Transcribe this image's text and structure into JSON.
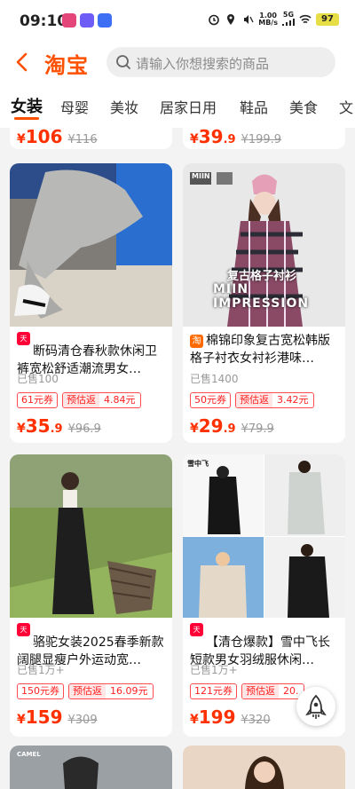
{
  "status_bar": {
    "time": "09:10",
    "net_speed_value": "1.00",
    "net_speed_unit": "MB/s",
    "network_type": "5G",
    "battery": "97"
  },
  "header": {
    "logo": "淘宝",
    "search_placeholder": "请输入你想搜索的商品"
  },
  "tabs": [
    "女装",
    "母婴",
    "美妆",
    "居家日用",
    "鞋品",
    "美食",
    "文"
  ],
  "top_partial": [
    {
      "price_int": "106",
      "price_dec": "",
      "original": "116"
    },
    {
      "price_int": "39",
      "price_dec": ".9",
      "original": "199.9"
    }
  ],
  "products": [
    {
      "badge": "天猫",
      "title": "断码清仓春秋款休闲卫裤宽松舒适潮流男女…",
      "sold": "已售100",
      "coupon": "61元券",
      "rebate_label": "预估返",
      "rebate_value": "4.84元",
      "price_int": "35",
      "price_dec": ".9",
      "original": "96.9"
    },
    {
      "badge": "淘",
      "title": "棉锦印象复古宽松韩版格子衬衣女衬衫港味…",
      "sold": "已售1400",
      "coupon": "50元券",
      "rebate_label": "预估返",
      "rebate_value": "3.42元",
      "price_int": "29",
      "price_dec": ".9",
      "original": "79.9",
      "image_text": {
        "top": "复古格子衬衫",
        "bottom": "MIIN IMPRESSION",
        "brand": "MIIN"
      }
    },
    {
      "badge": "天猫",
      "title": "骆驼女装2025春季新款阔腿显瘦户外运动宽…",
      "sold": "已售1万+",
      "coupon": "150元券",
      "rebate_label": "预估返",
      "rebate_value": "16.09元",
      "price_int": "159",
      "price_dec": "",
      "original": "309"
    },
    {
      "badge": "天猫",
      "title": "【清仓爆款】雪中飞长短款男女羽绒服休闲…",
      "sold": "已售1万+",
      "coupon": "121元券",
      "rebate_label": "预估返",
      "rebate_value": "20.",
      "price_int": "199",
      "price_dec": "",
      "original": "320",
      "image_text": {
        "brand": "雪中飞"
      }
    }
  ],
  "bottom_row": {
    "left_brand": "CAMEL"
  },
  "colors": {
    "accent": "#ff5000",
    "price": "#ff3000",
    "tmall": "#ff0036"
  }
}
